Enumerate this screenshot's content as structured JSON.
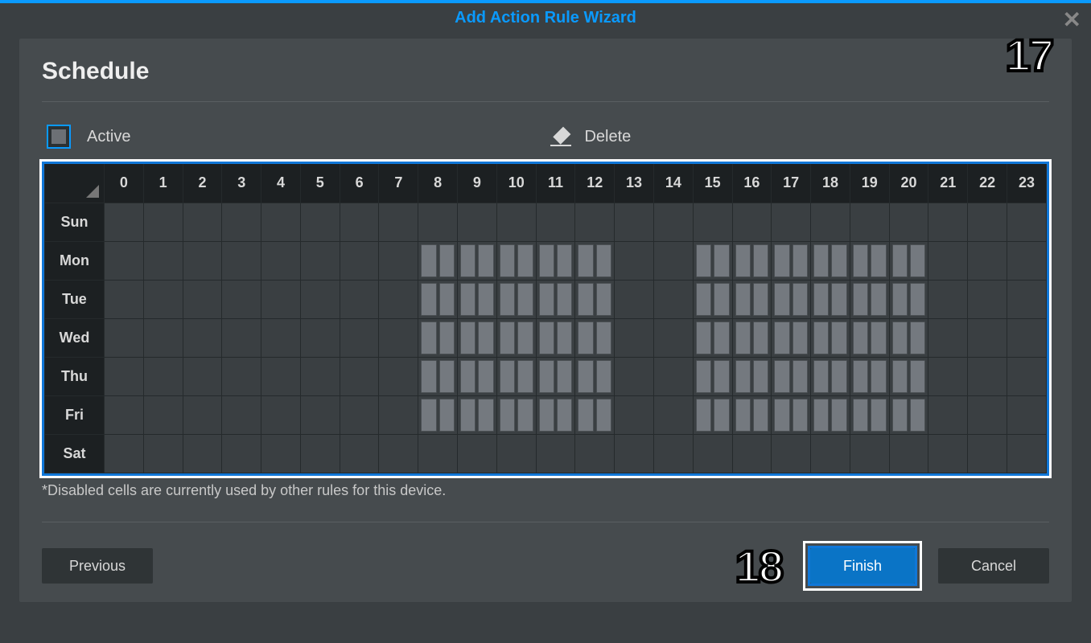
{
  "dialog": {
    "title": "Add Action Rule Wizard",
    "section_title": "Schedule",
    "active_label": "Active",
    "delete_label": "Delete",
    "footnote": "*Disabled cells are currently used by other rules for this device.",
    "hours": [
      "0",
      "1",
      "2",
      "3",
      "4",
      "5",
      "6",
      "7",
      "8",
      "9",
      "10",
      "11",
      "12",
      "13",
      "14",
      "15",
      "16",
      "17",
      "18",
      "19",
      "20",
      "21",
      "22",
      "23"
    ],
    "days": [
      "Sun",
      "Mon",
      "Tue",
      "Wed",
      "Thu",
      "Fri",
      "Sat"
    ],
    "buttons": {
      "previous": "Previous",
      "finish": "Finish",
      "cancel": "Cancel"
    },
    "callouts": {
      "c17": "17",
      "c18": "18"
    }
  },
  "schedule": {
    "Sun": [],
    "Mon": [
      8,
      9,
      10,
      11,
      12,
      15,
      16,
      17,
      18,
      19,
      20
    ],
    "Tue": [
      8,
      9,
      10,
      11,
      12,
      15,
      16,
      17,
      18,
      19,
      20
    ],
    "Wed": [
      8,
      9,
      10,
      11,
      12,
      15,
      16,
      17,
      18,
      19,
      20
    ],
    "Thu": [
      8,
      9,
      10,
      11,
      12,
      15,
      16,
      17,
      18,
      19,
      20
    ],
    "Fri": [
      8,
      9,
      10,
      11,
      12,
      15,
      16,
      17,
      18,
      19,
      20
    ],
    "Sat": []
  }
}
